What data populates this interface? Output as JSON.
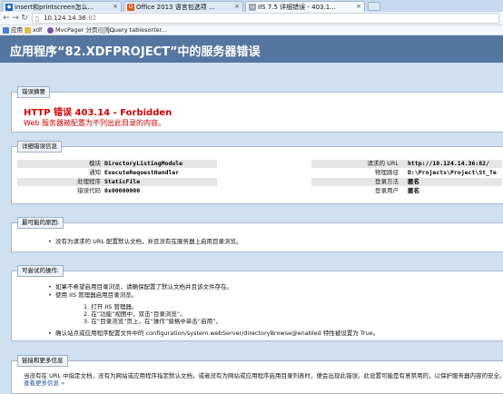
{
  "browser": {
    "tabs": [
      {
        "label": "insert和printscreen怎么..."
      },
      {
        "label": "Office 2013 语言包选项 ..."
      },
      {
        "label": "IIS 7.5 详细错误 - 403.1..."
      }
    ],
    "address": {
      "host": "10.124.14.36",
      "port": ":82"
    },
    "bookmarks": [
      {
        "label": "应用"
      },
      {
        "label": "xdf"
      },
      {
        "label": "MvcPager 分页示例..."
      },
      {
        "label": "jQuery tablesorter..."
      }
    ]
  },
  "page": {
    "title": "应用程序“82.XDFPROJECT”中的服务器错误",
    "summary": {
      "legend": "错误摘要",
      "error_title": "HTTP 错误 403.14 - Forbidden",
      "error_desc": "Web 服务器被配置为不列出此目录的内容。"
    },
    "details": {
      "legend": "详细错误信息",
      "left": [
        {
          "label": "模块",
          "value": "DirectoryListingModule"
        },
        {
          "label": "通知",
          "value": "ExecuteRequestHandler"
        },
        {
          "label": "处理程序",
          "value": "StaticFile"
        },
        {
          "label": "错误代码",
          "value": "0x00000000"
        }
      ],
      "right": [
        {
          "label": "请求的 URL",
          "value": "http://10.124.14.36:82/"
        },
        {
          "label": "物理路径",
          "value": "D:\\Projects\\Project\\St_Te"
        },
        {
          "label": "登录方法",
          "value": "匿名"
        },
        {
          "label": "登录用户",
          "value": "匿名"
        }
      ]
    },
    "causes": {
      "legend": "最可能的原因:",
      "items": [
        "没有为请求的 URL 配置默认文档，并且没有在服务器上启用目录浏览。"
      ]
    },
    "actions": {
      "legend": "可尝试的操作:",
      "items": [
        "如果不希望启用目录浏览，请确保配置了默认文档并且该文件存在。",
        "使用 IIS 管理器启用目录浏览。"
      ],
      "steps": [
        "1. 打开 IIS 管理器。",
        "2. 在“功能”视图中，双击“目录浏览”。",
        "3. 在“目录浏览”页上，在“操作”窗格中单击“启用”。"
      ],
      "last_item": "确认站点或应用程序配置文件中的 configuration/system.webServer/directoryBrowse@enabled 特性被设置为 True。"
    },
    "links": {
      "legend": "链接和更多信息",
      "text": "当没有在 URL 中指定文档，没有为网站或应用程序指定默认文档，或者没有为网站或应用程序启用目录列表时，便会出现此错误。此设置可能是有意禁用的，以保护服务器内容的安全。",
      "more": "查看更多信息 »"
    }
  },
  "colors": {
    "header_bg": "#5576a0",
    "error_red": "#cc0000",
    "page_bg": "#cfe0f1"
  }
}
